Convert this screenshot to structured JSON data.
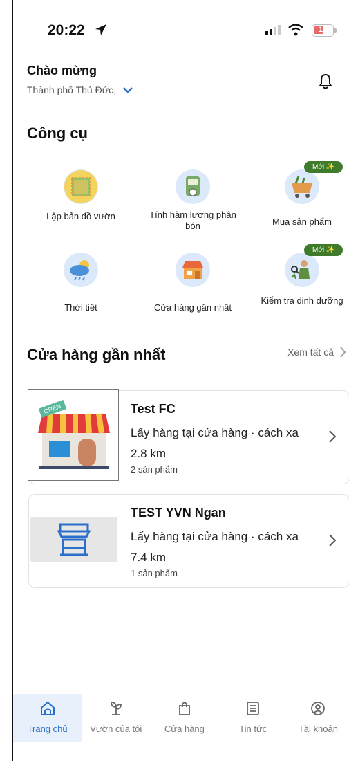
{
  "status_bar": {
    "time": "20:22",
    "battery": "13"
  },
  "header": {
    "greeting": "Chào mừng",
    "location": "Thành phố Thủ Đức,"
  },
  "tools": {
    "title": "Công cụ",
    "items": [
      {
        "label": "Lập bản đồ vườn",
        "icon": "garden-map-icon"
      },
      {
        "label": "Tính hàm lượng phân bón",
        "icon": "fertilizer-calculator-icon"
      },
      {
        "label": "Mua sản phẩm",
        "icon": "shopping-cart-icon",
        "badge": "Mới ✨"
      },
      {
        "label": "Thời tiết",
        "icon": "weather-icon"
      },
      {
        "label": "Cửa hàng gần nhất",
        "icon": "store-icon"
      },
      {
        "label": "Kiểm tra dinh dưỡng",
        "icon": "nutrition-check-icon",
        "badge": "Mới ✨"
      }
    ]
  },
  "nearby": {
    "title": "Cửa hàng gần nhất",
    "see_all": "Xem tất cả",
    "stores": [
      {
        "name": "Test FC",
        "desc": "Lấy hàng tại cửa hàng · cách xa 2.8 km",
        "count": "2 sản phẩm",
        "sign": "OPEN"
      },
      {
        "name": "TEST YVN Ngan",
        "desc": "Lấy hàng tại cửa hàng · cách xa 7.4 km",
        "count": "1 sản phẩm"
      }
    ]
  },
  "nav": {
    "items": [
      {
        "label": "Trang chủ",
        "icon": "home-icon",
        "active": true
      },
      {
        "label": "Vườn của tôi",
        "icon": "plant-icon"
      },
      {
        "label": "Cửa hàng",
        "icon": "shopping-bag-icon"
      },
      {
        "label": "Tin tức",
        "icon": "news-icon"
      },
      {
        "label": "Tài khoản",
        "icon": "account-icon"
      }
    ]
  },
  "colors": {
    "accent": "#2a6fc9",
    "badge": "#3f7b2a",
    "icon_bg": "#dbe9fb"
  }
}
